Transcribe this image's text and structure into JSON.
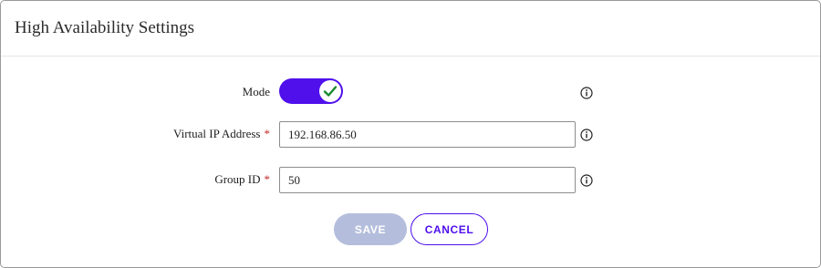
{
  "dialog": {
    "title": "High Availability Settings"
  },
  "form": {
    "mode": {
      "label": "Mode",
      "enabled": true,
      "info_icon": "info-circle-icon"
    },
    "virtual_ip": {
      "label": "Virtual IP Address",
      "required_marker": "*",
      "value": "192.168.86.50",
      "info_icon": "info-circle-icon"
    },
    "group_id": {
      "label": "Group ID",
      "required_marker": "*",
      "value": "50",
      "info_icon": "info-circle-icon"
    }
  },
  "actions": {
    "save_label": "SAVE",
    "save_enabled": false,
    "cancel_label": "CANCEL"
  },
  "colors": {
    "accent": "#4f10ec",
    "check": "#1a8a2e",
    "disabled_button": "#b4bedc",
    "required": "#c62828"
  }
}
